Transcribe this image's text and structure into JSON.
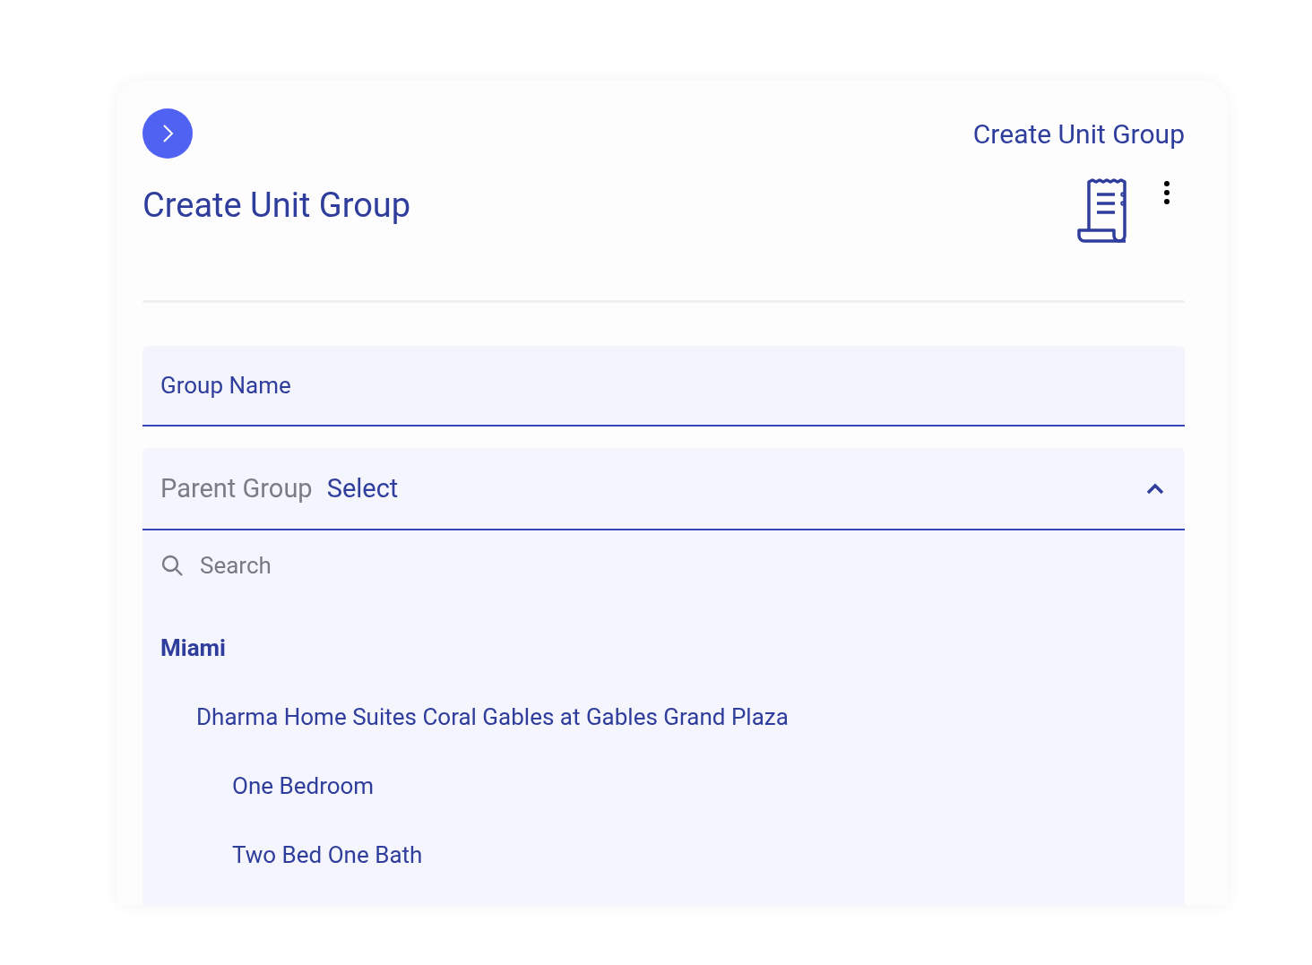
{
  "header": {
    "breadcrumb": "Create Unit Group",
    "title": "Create Unit Group"
  },
  "form": {
    "group_name": {
      "placeholder": "Group Name"
    },
    "parent_group": {
      "label": "Parent Group",
      "value": "Select",
      "expanded": true,
      "search": {
        "placeholder": "Search"
      },
      "options": [
        {
          "label": "Miami",
          "children": [
            {
              "label": "Dharma Home Suites Coral Gables at Gables Grand Plaza",
              "children": [
                {
                  "label": "One Bedroom"
                },
                {
                  "label": "Two Bed One Bath"
                }
              ]
            }
          ]
        }
      ]
    }
  }
}
